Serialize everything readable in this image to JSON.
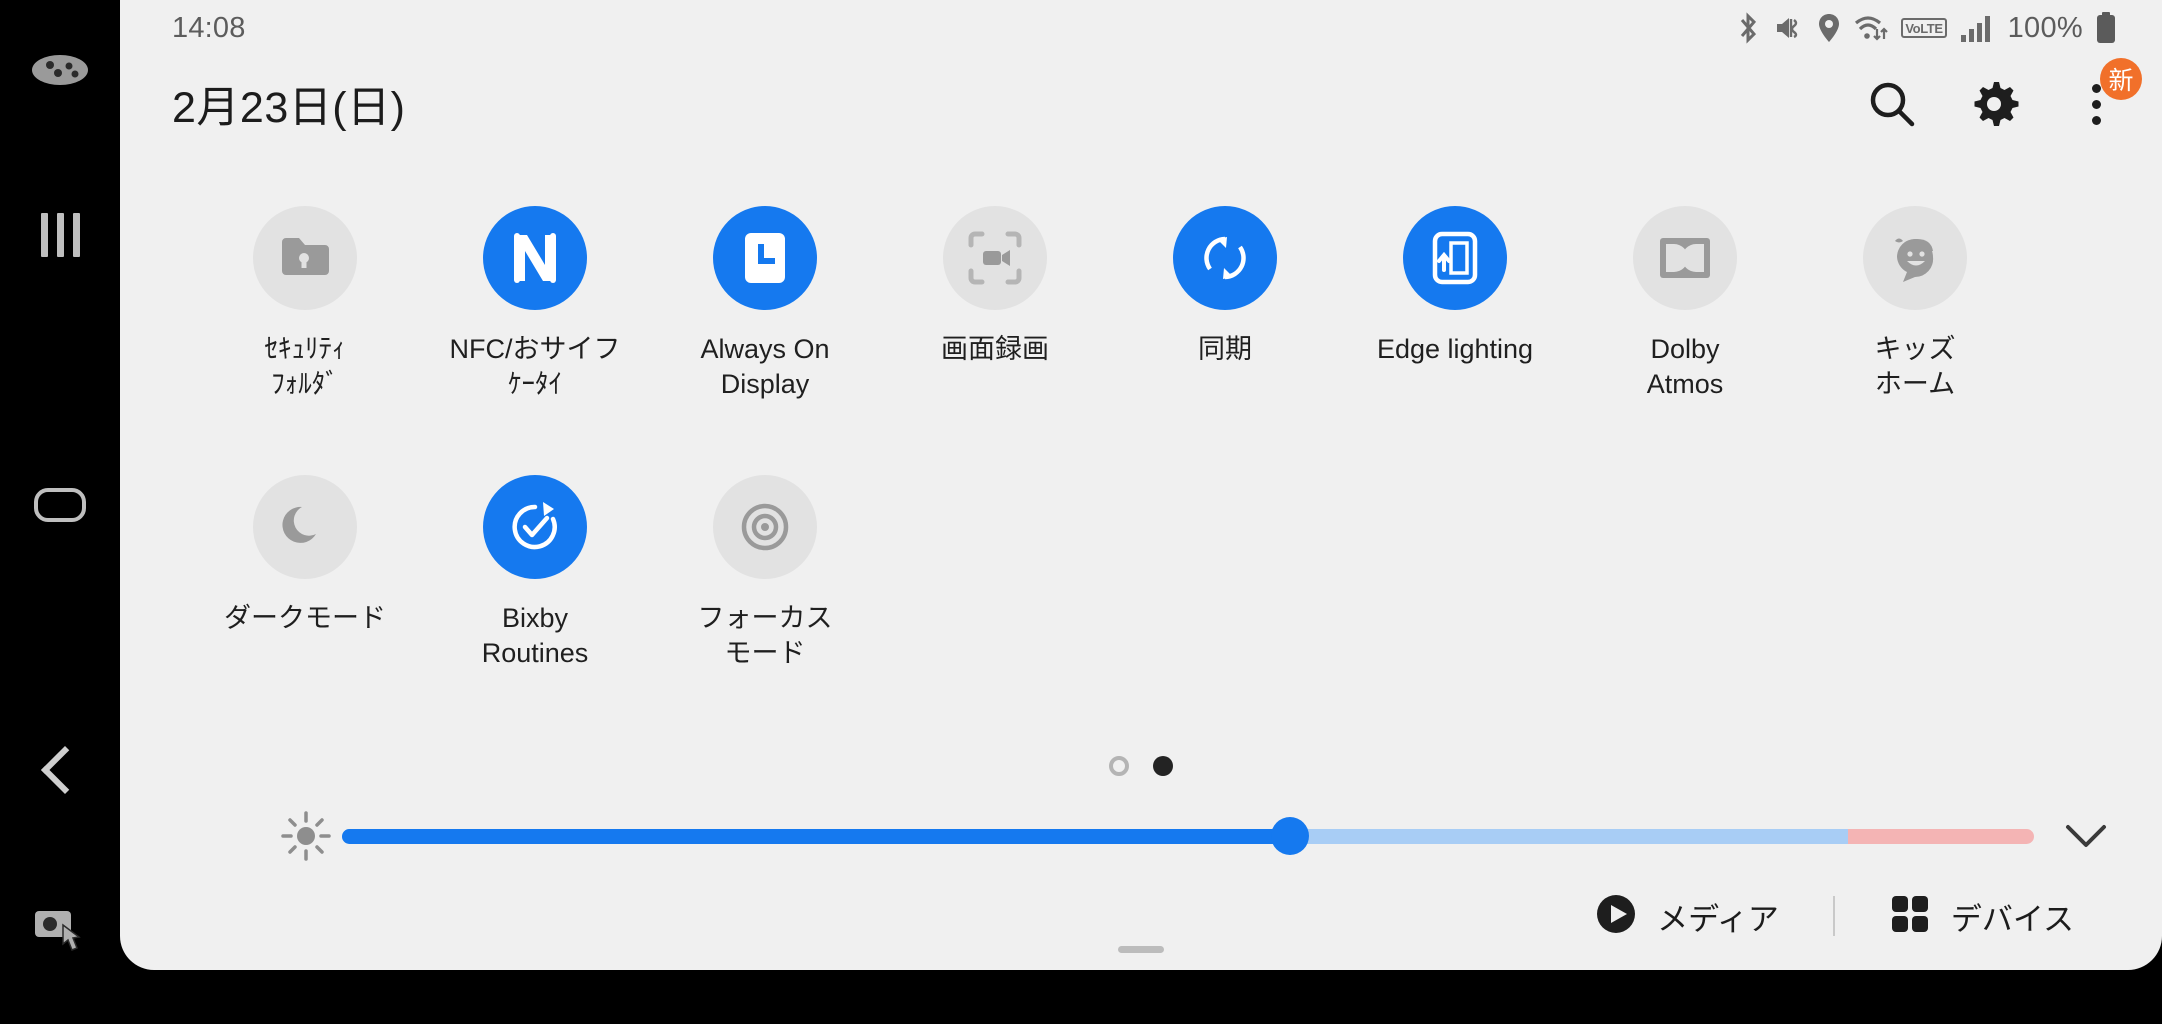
{
  "theme": {
    "accent_on": "#1579ef",
    "tile_off_bg": "#e2e2e2",
    "panel_bg": "#f0f0f0",
    "badge_orange": "#f1702a",
    "slider_pink": "#f4b4b4",
    "slider_light_blue": "#a8cdf5"
  },
  "nav_rail": {
    "items": [
      {
        "name": "game-launcher-icon",
        "label": "Game Launcher"
      },
      {
        "name": "recents-icon",
        "label": "Recents"
      },
      {
        "name": "home-icon",
        "label": "Home"
      },
      {
        "name": "back-icon",
        "label": "Back"
      },
      {
        "name": "screenshot-capture-icon",
        "label": "Capture"
      }
    ]
  },
  "statusbar": {
    "time": "14:08",
    "battery_percent": "100%",
    "volte_label": "VoLTE",
    "icons": [
      "bluetooth-icon",
      "mute-vibrate-icon",
      "location-icon",
      "wifi-icon",
      "volte-icon",
      "signal-bars-icon",
      "battery-icon"
    ]
  },
  "header": {
    "date": "2月23日(日)",
    "search_label": "検索",
    "settings_label": "設定",
    "more_label": "その他",
    "more_badge": "新"
  },
  "tiles": {
    "rows": [
      [
        {
          "label": "ｾｷｭﾘﾃｨ\nﾌｫﾙﾀﾞ",
          "state": "off",
          "icon": "secure-folder-icon"
        },
        {
          "label": "NFC/おサイフ\nｹｰﾀｲ",
          "state": "on",
          "icon": "nfc-icon"
        },
        {
          "label": "Always On\nDisplay",
          "state": "on",
          "icon": "always-on-display-icon"
        },
        {
          "label": "画面録画",
          "state": "off",
          "icon": "screen-recorder-icon"
        },
        {
          "label": "同期",
          "state": "on",
          "icon": "sync-icon"
        },
        {
          "label": "Edge lighting",
          "state": "on",
          "icon": "edge-lighting-icon"
        },
        {
          "label": "Dolby\nAtmos",
          "state": "off",
          "icon": "dolby-atmos-icon"
        },
        {
          "label": "キッズ\nホーム",
          "state": "off",
          "icon": "kids-home-icon"
        }
      ],
      [
        {
          "label": "ダークモード",
          "state": "off",
          "icon": "dark-mode-icon"
        },
        {
          "label": "Bixby\nRoutines",
          "state": "on",
          "icon": "bixby-routines-icon"
        },
        {
          "label": "フォーカス\nモード",
          "state": "off",
          "icon": "focus-mode-icon"
        }
      ]
    ]
  },
  "pager": {
    "total_pages": 2,
    "current_page": 2
  },
  "brightness": {
    "value_percent": 56,
    "extra_zone_start_percent": 89,
    "icon": "brightness-icon",
    "expand_icon": "chevron-down-icon"
  },
  "bottombar": {
    "media_label": "メディア",
    "devices_label": "デバイス"
  }
}
